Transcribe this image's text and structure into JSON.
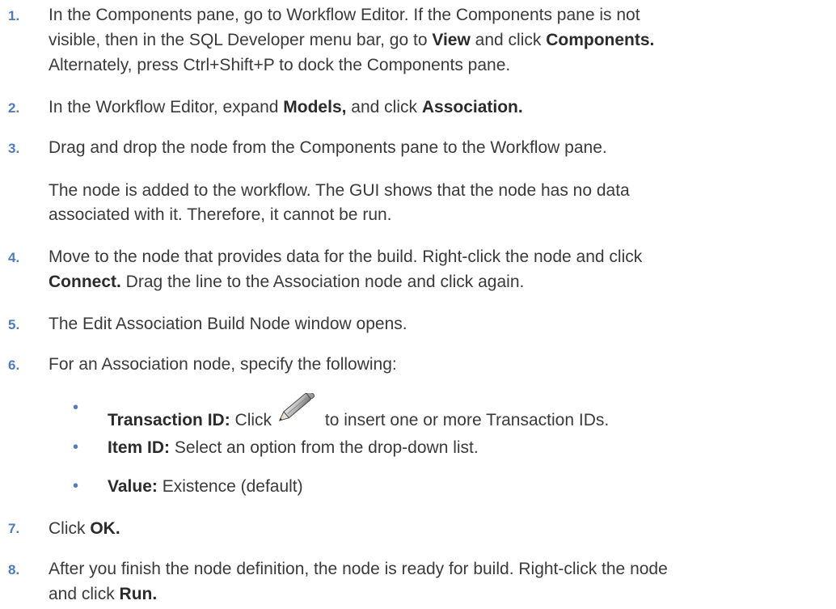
{
  "steps": [
    {
      "num": "1.",
      "lines": [
        {
          "text": "In the Components pane, go to Workflow Editor. If the Components pane is not"
        },
        {
          "a": "visible, then in the SQL Developer menu bar, go to ",
          "b1": "View",
          "c": " and click ",
          "b2": "Components."
        },
        {
          "text": "Alternately, press Ctrl+Shift+P to dock the Components pane."
        }
      ]
    },
    {
      "num": "2.",
      "a": "In the Workflow Editor, expand ",
      "b1": "Models,",
      "c": " and click ",
      "b2": "Association."
    },
    {
      "num": "3.",
      "text": "Drag and drop the node from the Components pane to the Workflow pane."
    },
    {
      "note": [
        "The node is added to the workflow. The GUI shows that the node has no data",
        "associated with it. Therefore, it cannot be run."
      ]
    },
    {
      "num": "4.",
      "line1": "Move to the node that provides data for the build. Right-click the node and click",
      "b": "Connect.",
      "line2": " Drag the line to the Association node and click again."
    },
    {
      "num": "5.",
      "text": "The Edit Association Build Node window opens."
    },
    {
      "num": "6.",
      "text": "For an Association node, specify the following:"
    },
    {
      "num": "7.",
      "a": "Click ",
      "b": "OK."
    },
    {
      "num": "8.",
      "line1": "After you finish the node definition, the node is ready for build. Right-click the node",
      "a": "and click ",
      "b": "Run."
    }
  ],
  "sub_items": [
    {
      "label": "Transaction ID:",
      "before_icon": " Click ",
      "icon": "pencil-icon",
      "after_icon": "to insert one or more Transaction IDs."
    },
    {
      "label": "Item ID:",
      "text": " Select an option from the drop-down list."
    },
    {
      "label": "Value:",
      "text": " Existence (default)"
    }
  ],
  "bullet_char": "•",
  "colors": {
    "number": "#4f7bbd",
    "text": "#3a3a3a"
  }
}
